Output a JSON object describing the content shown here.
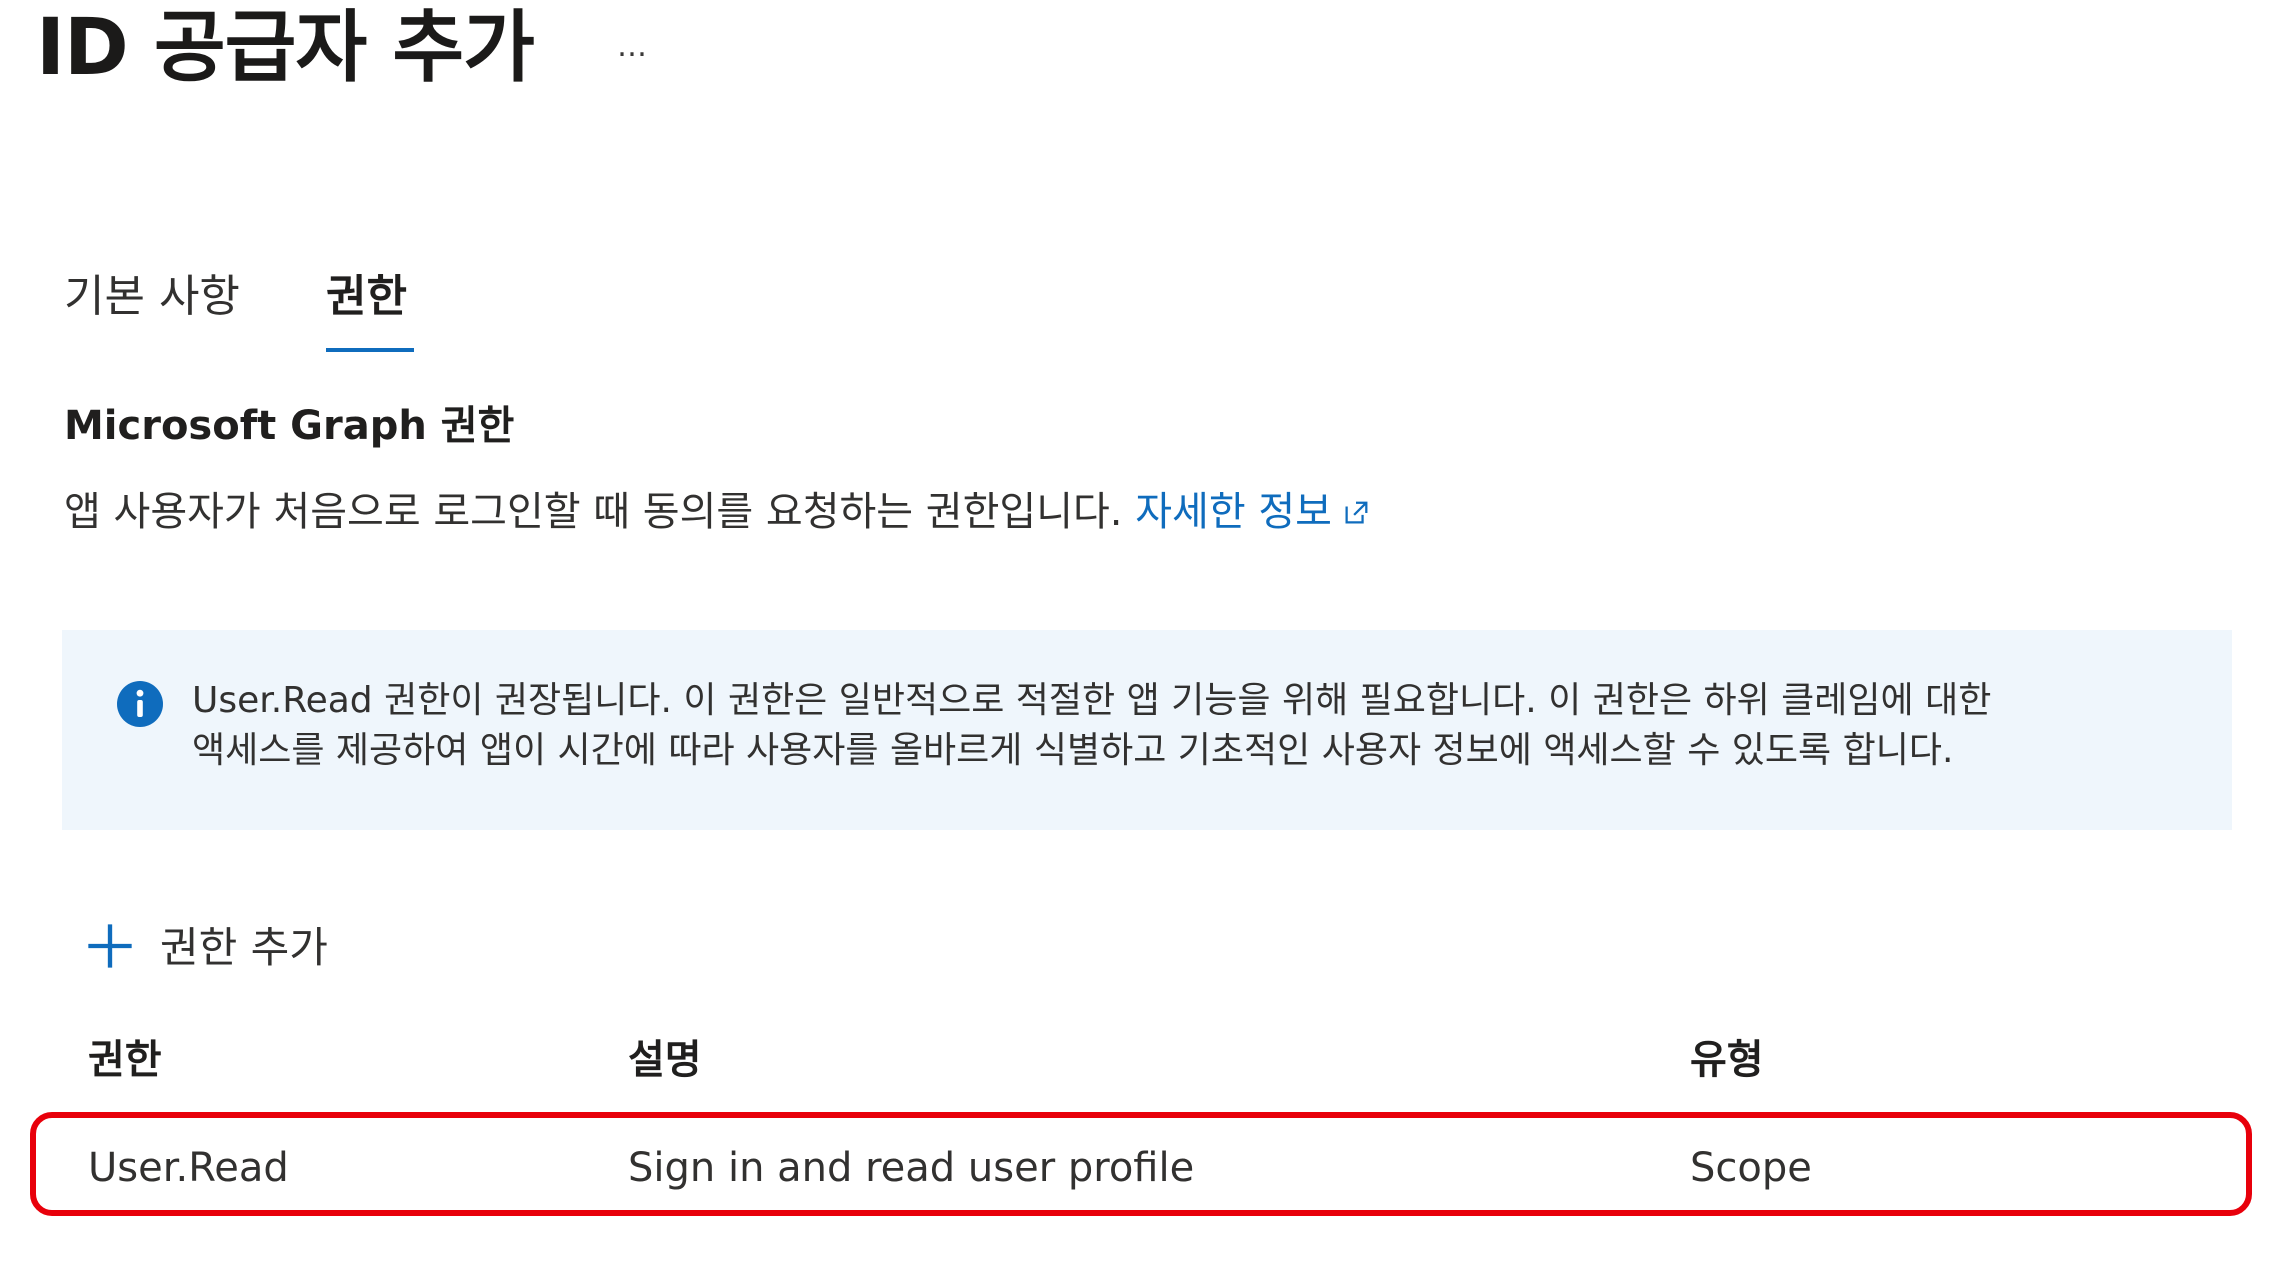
{
  "header": {
    "title": "ID 공급자 추가",
    "more_label": "…"
  },
  "tabs": [
    {
      "label": "기본 사항",
      "selected": false
    },
    {
      "label": "권한",
      "selected": true
    }
  ],
  "section": {
    "heading": "Microsoft Graph 권한",
    "description": "앱 사용자가 처음으로 로그인할 때 동의를 요청하는 권한입니다.",
    "learn_more": "자세한 정보"
  },
  "info_banner": {
    "icon": "info-icon",
    "line1": "User.Read 권한이 권장됩니다. 이 권한은 일반적으로 적절한 앱 기능을 위해 필요합니다. 이 권한은 하위 클레임에 대한",
    "line2": "액세스를 제공하여 앱이 시간에 따라 사용자를 올바르게 식별하고 기초적인 사용자 정보에 액세스할 수 있도록 합니다."
  },
  "add_permission": {
    "icon": "plus-icon",
    "label": "권한 추가"
  },
  "table": {
    "columns": [
      "권한",
      "설명",
      "유형"
    ],
    "rows": [
      [
        "User.Read",
        "Sign in and read user profile",
        "Scope"
      ]
    ]
  },
  "colors": {
    "accent": "#0f6cbd",
    "banner_bg": "#eff6fc",
    "highlight": "#e8000b"
  }
}
